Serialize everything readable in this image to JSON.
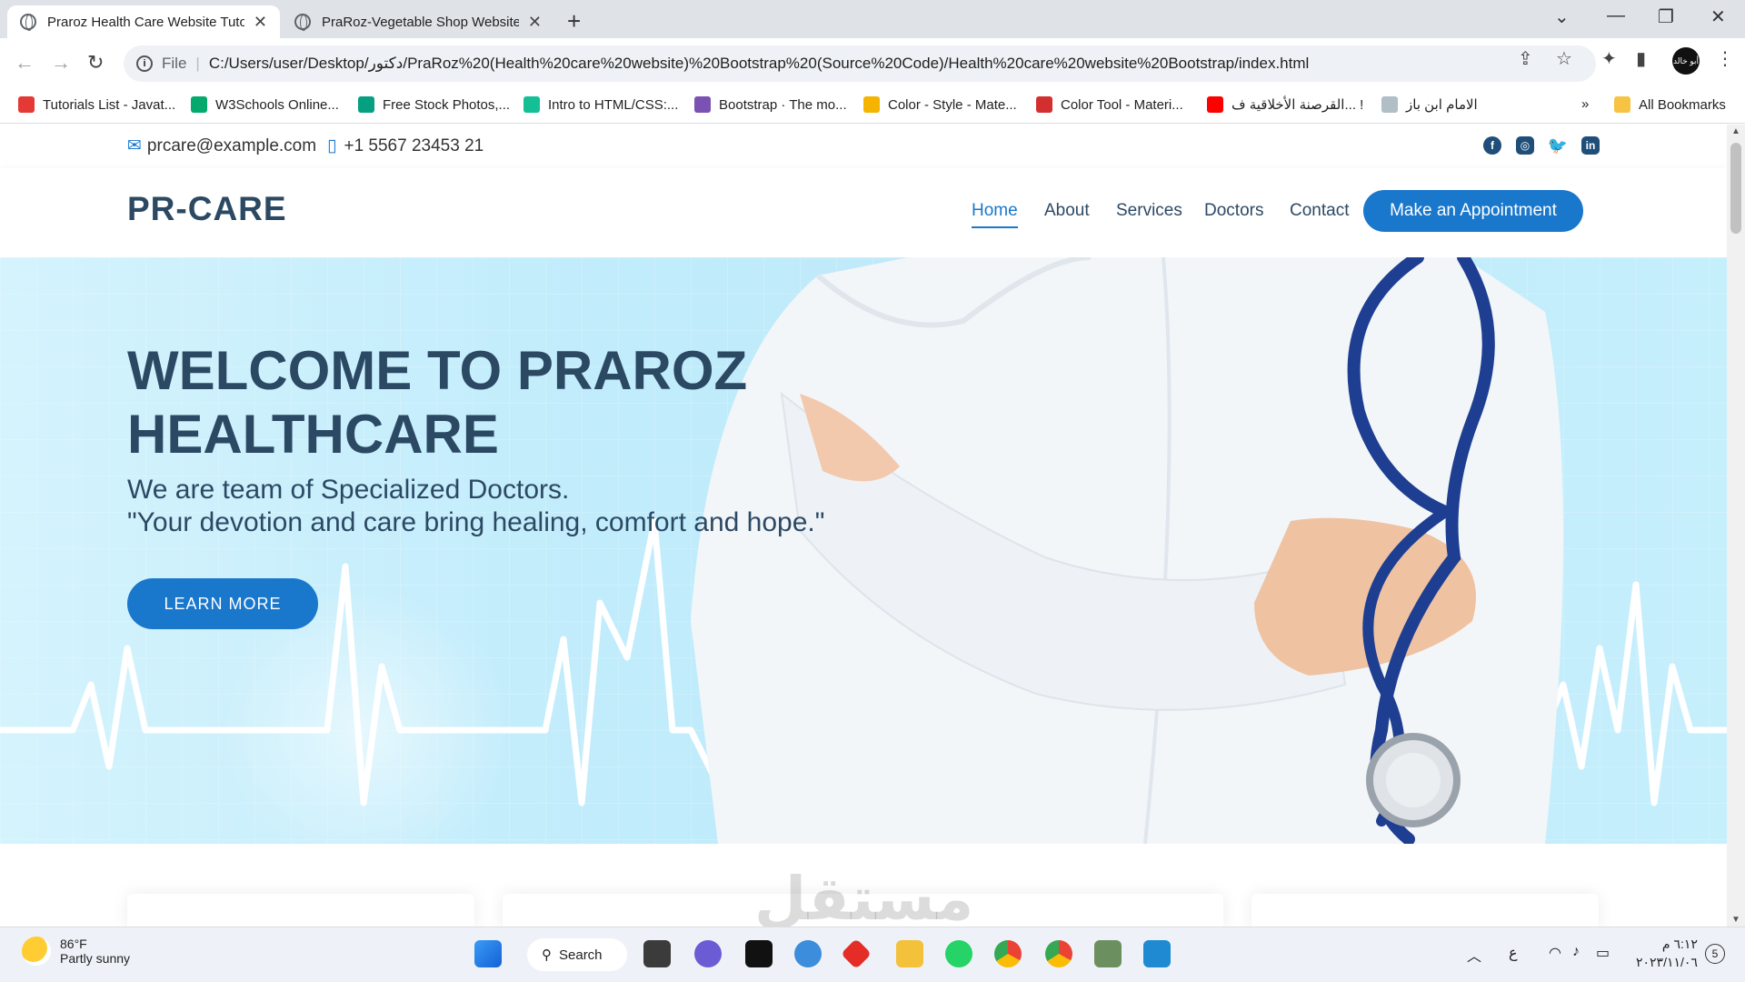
{
  "browser": {
    "tabs": [
      {
        "title": "Praroz Health Care Website Tuto",
        "active": true
      },
      {
        "title": "PraRoz-Vegetable Shop Website",
        "active": false
      }
    ],
    "address_prefix": "File",
    "address": "C:/Users/user/Desktop/دكتور/PraRoz%20(Health%20care%20website)%20Bootstrap%20(Source%20Code)/Health%20care%20website%20Bootstrap/index.html",
    "bookmarks": [
      {
        "label": "Tutorials List - Javat...",
        "color": "#e53935"
      },
      {
        "label": "W3Schools Online...",
        "color": "#04aa6d"
      },
      {
        "label": "Free Stock Photos,...",
        "color": "#05a081"
      },
      {
        "label": "Intro to HTML/CSS:...",
        "color": "#14bf96"
      },
      {
        "label": "Bootstrap · The mo...",
        "color": "#7952b3"
      },
      {
        "label": "Color - Style - Mate...",
        "color": "#f4b400"
      },
      {
        "label": "Color Tool - Materi...",
        "color": "#d32f2f"
      },
      {
        "label": "القرصنة الأخلاقية ف... !",
        "color": "#ff0000"
      },
      {
        "label": "الامام ابن باز",
        "color": "#b0bec5"
      }
    ],
    "all_bookmarks": "All Bookmarks",
    "profile_label": "أبو خالد"
  },
  "site": {
    "email": "prcare@example.com",
    "phone": "+1 5567 23453 21",
    "logo": "PR-CARE",
    "nav": [
      "Home",
      "About",
      "Services",
      "Doctors",
      "Contact"
    ],
    "cta": "Make an Appointment",
    "hero": {
      "title": "WELCOME TO PRAROZ HEALTHCARE",
      "subtitle_1": "We are team of Specialized Doctors.",
      "subtitle_2": "\"Your devotion and care bring healing, comfort and hope.\"",
      "button": "LEARN MORE"
    },
    "watermark": "مستقل",
    "colors": {
      "brand": "#2c4964",
      "accent": "#1977cc"
    }
  },
  "taskbar": {
    "temp": "86°F",
    "condition": "Partly sunny",
    "search": "Search",
    "time": "٦:١٢ م",
    "date": "٢٠٢٣/١١/٠٦",
    "lang": "ع",
    "notifications": "5"
  }
}
